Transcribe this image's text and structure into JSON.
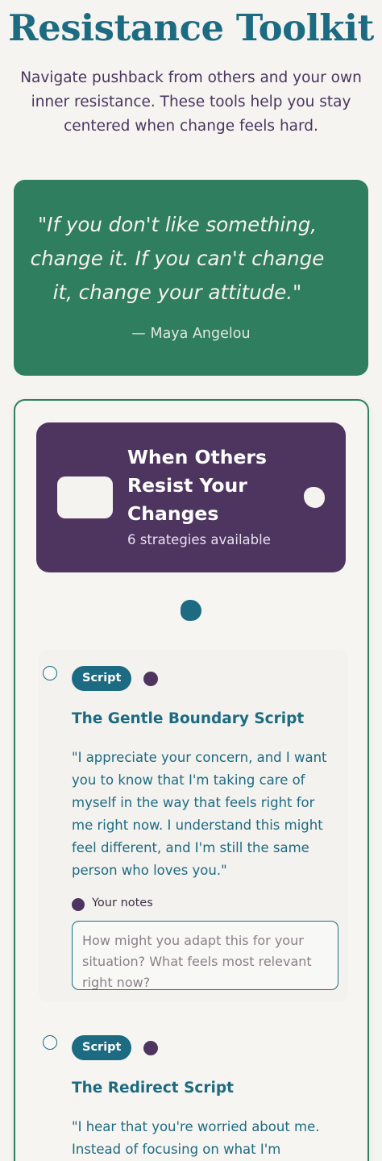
{
  "page": {
    "title": "Resistance Toolkit",
    "subtitle": "Navigate pushback from others and your own inner resistance. These tools help you stay centered when change feels hard."
  },
  "quote": {
    "text": "\"If you don't like something, change it. If you can't change it, change your attitude.\"",
    "author": "— Maya Angelou"
  },
  "section": {
    "title": "When Others Resist Your Changes",
    "count": "6 strategies available"
  },
  "strategies": [
    {
      "tag": "Script",
      "title": "The Gentle Boundary Script",
      "text": "\"I appreciate your concern, and I want you to know that I'm taking care of myself in the way that feels right for me right now. I understand this might feel different, and I'm still the same person who loves you.\"",
      "notes_label": "Your notes",
      "notes_placeholder": "How might you adapt this for your situation? What feels most relevant right now?"
    },
    {
      "tag": "Script",
      "title": "The Redirect Script",
      "text": "\"I hear that you're worried about me. Instead of focusing on what I'm"
    }
  ],
  "colors": {
    "background": "#f5f4f0",
    "teal": "#1d6b82",
    "green": "#2e7e5f",
    "purple": "#4e3560"
  }
}
